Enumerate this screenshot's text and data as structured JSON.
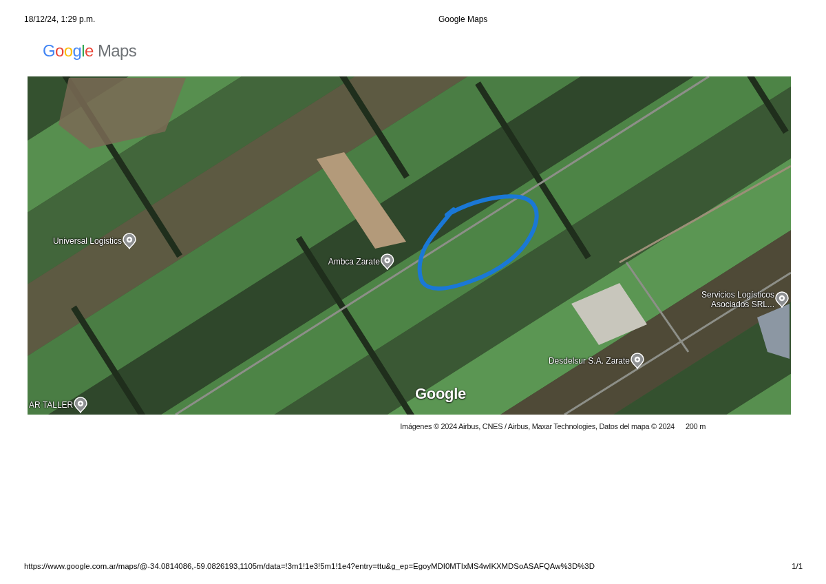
{
  "print_header": {
    "date_time": "18/12/24, 1:29 p.m.",
    "title": "Google Maps"
  },
  "logo": {
    "brand": "Google",
    "product": "Maps"
  },
  "map": {
    "places": [
      {
        "name": "Universal Logistics"
      },
      {
        "name": "Ambca Zarate"
      },
      {
        "name": "Servicios Logísticos Asociados SRL..."
      },
      {
        "name": "Desdelsur S.A. Zarate"
      },
      {
        "name": "AR TALLER"
      }
    ],
    "logo": "Google"
  },
  "attribution": {
    "credits": "Imágenes © 2024 Airbus, CNES / Airbus, Maxar Technologies, Datos del mapa © 2024",
    "scale": "200 m"
  },
  "print_footer": {
    "url": "https://www.google.com.ar/maps/@-34.0814086,-59.0826193,1105m/data=!3m1!1e3!5m1!1e4?entry=ttu&g_ep=EgoyMDI0MTIxMS4wIKXMDSoASAFQAw%3D%3D",
    "page": "1/1"
  }
}
